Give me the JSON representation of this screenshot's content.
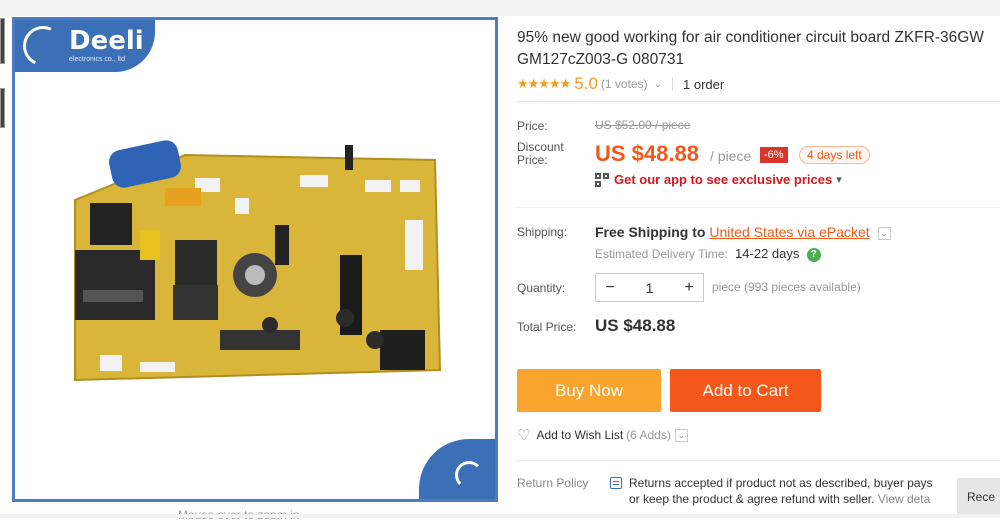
{
  "product": {
    "title_line1": "95% new good working for air conditioner circuit board ZKFR-36GW",
    "title_line2": "GM127cZ003-G 080731",
    "rating": {
      "stars": "★★★★★",
      "value": "5.0",
      "votes": "(1 votes)",
      "chevron": "⌄"
    },
    "orders": "1 order"
  },
  "image": {
    "brand": "Deeli",
    "brand_sub": "electronics co., ltd",
    "zoom_hint": "Mouse over to zoom in"
  },
  "price": {
    "price_label": "Price:",
    "original": "US $52.00 / piece",
    "discount_label": "Discount Price:",
    "discount_value": "US $48.88",
    "per_piece": "/ piece",
    "off": "-6%",
    "days_left": "4 days left",
    "app_promo": "Get our app to see exclusive prices",
    "app_chevron": "▾"
  },
  "shipping": {
    "label": "Shipping:",
    "free": "Free Shipping to",
    "destination": "United States via ePacket",
    "est_label": "Estimated Delivery Time:",
    "est_value": "14-22 days",
    "help": "?"
  },
  "quantity": {
    "label": "Quantity:",
    "minus": "−",
    "value": "1",
    "plus": "+",
    "available": "piece (993 pieces available)"
  },
  "total": {
    "label": "Total Price:",
    "value": "US $48.88"
  },
  "actions": {
    "buy_now": "Buy Now",
    "add_to_cart": "Add to Cart",
    "wishlist": "Add to Wish List",
    "wishlist_count": "(6 Adds)"
  },
  "return_policy": {
    "label": "Return Policy",
    "line1": "Returns accepted if product not as described, buyer pays",
    "line2": "or keep the product & agree refund with seller.",
    "view_link": "View deta"
  },
  "recent": "Rece",
  "colors": {
    "accent": "#f0591a",
    "buy": "#f8a42e",
    "cart": "#f3571a",
    "frame": "#3b6fb6",
    "board": "#d9b53a"
  }
}
